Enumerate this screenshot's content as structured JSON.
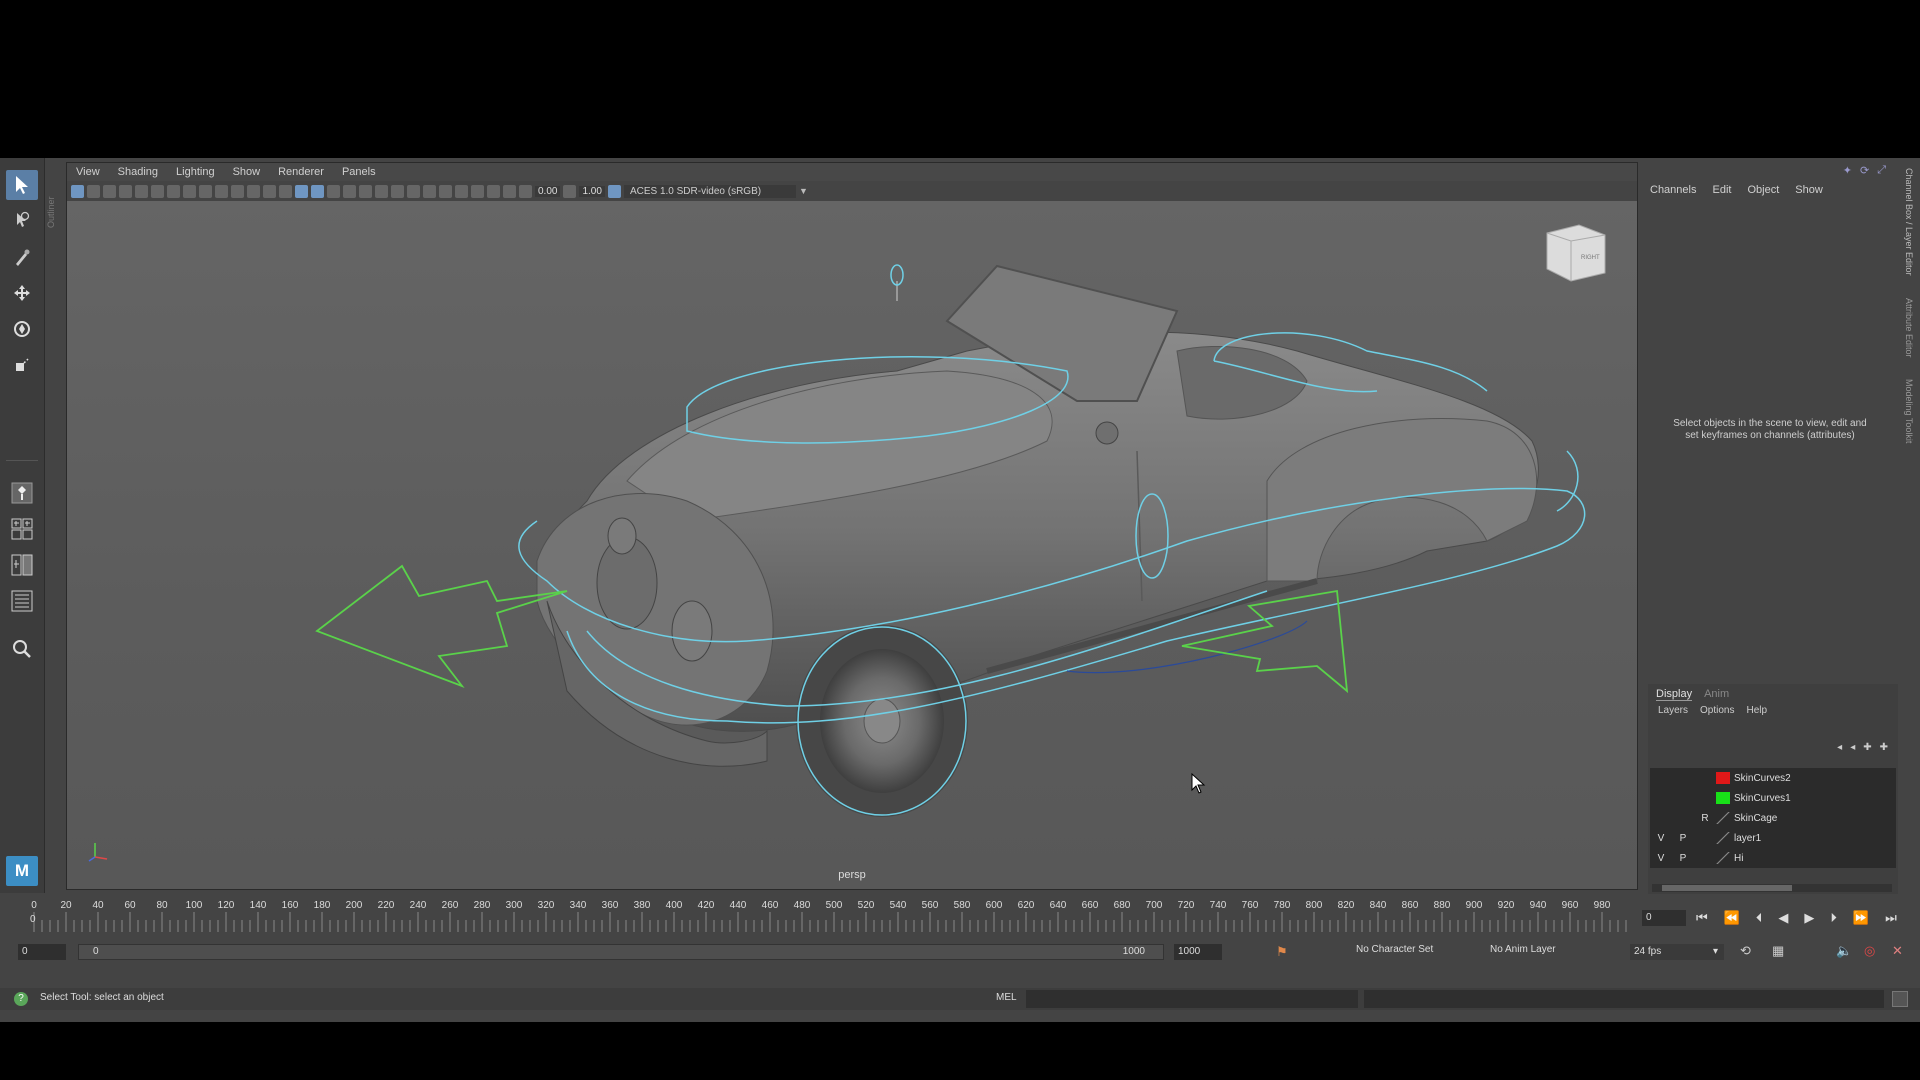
{
  "viewport": {
    "menus": [
      "View",
      "Shading",
      "Lighting",
      "Show",
      "Renderer",
      "Panels"
    ],
    "exposure": "0.00",
    "gamma": "1.00",
    "colorspace": "ACES 1.0 SDR-video (sRGB)",
    "camera_label": "persp",
    "viewcube_face": "RIGHT"
  },
  "outliner_tab": "Outliner",
  "channel_box": {
    "menus": [
      "Channels",
      "Edit",
      "Object",
      "Show"
    ],
    "info": "Select objects in the scene to view, edit and set keyframes on channels (attributes)",
    "side_tabs": [
      "Channel Box / Layer Editor",
      "Attribute Editor",
      "Modeling Toolkit"
    ]
  },
  "layer_editor": {
    "tabs": [
      "Display",
      "Anim"
    ],
    "menus": [
      "Layers",
      "Options",
      "Help"
    ],
    "layers": [
      {
        "v": "",
        "p": "",
        "r": "",
        "name": "SkinCurves2",
        "color": "#e01818"
      },
      {
        "v": "",
        "p": "",
        "r": "",
        "name": "SkinCurves1",
        "color": "#18e018"
      },
      {
        "v": "",
        "p": "",
        "r": "R",
        "name": "SkinCage",
        "color": ""
      },
      {
        "v": "V",
        "p": "P",
        "r": "",
        "name": "layer1",
        "color": ""
      },
      {
        "v": "V",
        "p": "P",
        "r": "",
        "name": "Hi",
        "color": ""
      }
    ]
  },
  "timeline": {
    "ticks": [
      "0",
      "20",
      "40",
      "60",
      "80",
      "100",
      "120",
      "140",
      "160",
      "180",
      "200",
      "220",
      "240",
      "260",
      "280",
      "300",
      "320",
      "340",
      "360",
      "380",
      "400",
      "420",
      "440",
      "460",
      "480",
      "500",
      "520",
      "540",
      "560",
      "580",
      "600",
      "620",
      "640",
      "660",
      "680",
      "700",
      "720",
      "740",
      "760",
      "780",
      "800",
      "820",
      "840",
      "860",
      "880",
      "900",
      "920",
      "940",
      "960",
      "980"
    ],
    "current_frame_marker": "0",
    "current_frame": "0"
  },
  "range": {
    "start": "0",
    "slider_start": "0",
    "slider_end": "1000",
    "end": "1000",
    "character_set": "No Character Set",
    "anim_layer": "No Anim Layer",
    "fps": "24 fps"
  },
  "status": {
    "help": "Select Tool: select an object",
    "mel_label": "MEL"
  },
  "colors": {
    "nurbs_curves": "#6fd0e6",
    "control_arrows": "#5ad24a",
    "active_tool": "#5b7fa6"
  }
}
